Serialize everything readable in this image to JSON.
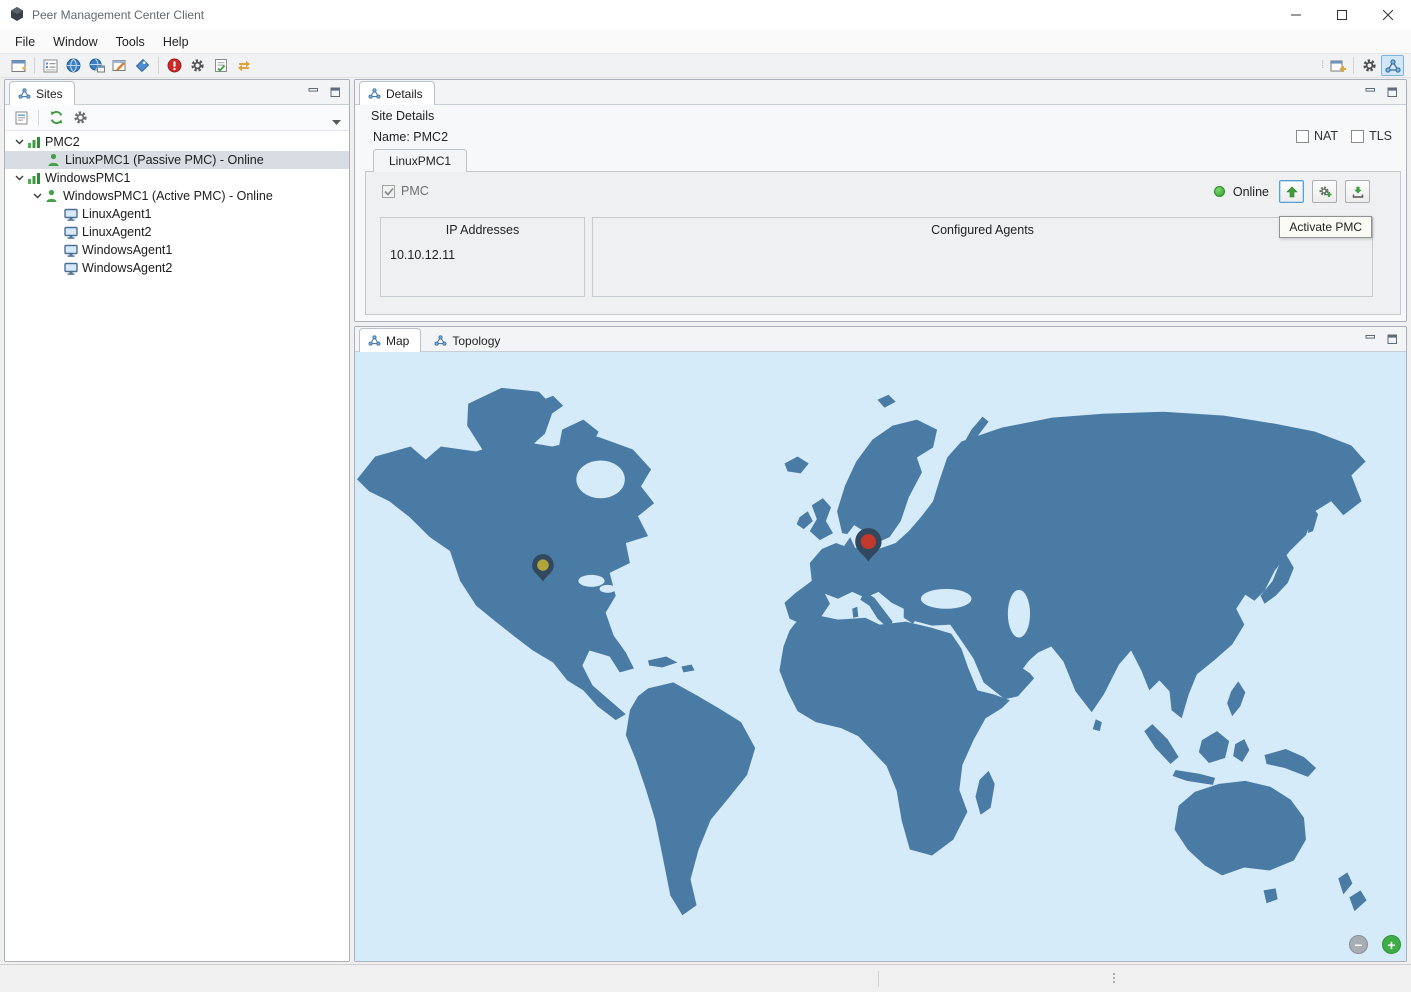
{
  "window": {
    "title": "Peer Management Center Client"
  },
  "menu": {
    "items": [
      "File",
      "Window",
      "Tools",
      "Help"
    ]
  },
  "toolbar": {
    "left_icons": [
      "new-window-icon",
      "form-list-icon",
      "globe-icon",
      "globe-sites-icon",
      "edit-window-icon",
      "tag-icon",
      "stop-icon",
      "gear-icon",
      "task-check-icon",
      "sync-arrows-icon"
    ],
    "right_icons": [
      "open-perspective-icon",
      "management-perspective-icon",
      "pmc-perspective-icon"
    ]
  },
  "sites": {
    "tab_label": "Sites",
    "toolbar_icons": [
      "report-icon",
      "refresh-icon",
      "gear-icon",
      "view-menu-icon"
    ],
    "tree": [
      {
        "label": "PMC2"
      },
      {
        "label": "LinuxPMC1 (Passive PMC) - Online"
      },
      {
        "label": "WindowsPMC1"
      },
      {
        "label": "WindowsPMC1 (Active PMC) - Online"
      },
      {
        "label": "LinuxAgent1"
      },
      {
        "label": "LinuxAgent2"
      },
      {
        "label": "WindowsAgent1"
      },
      {
        "label": "WindowsAgent2"
      }
    ]
  },
  "details": {
    "tab_label": "Details",
    "section_title": "Site Details",
    "name_label": "Name: PMC2",
    "nat_label": "NAT",
    "tls_label": "TLS",
    "pmc_tab_label": "LinuxPMC1",
    "pmc_checkbox_label": "PMC",
    "status_label": "Online",
    "tooltip": "Activate PMC",
    "ip_group": {
      "title": "IP Addresses",
      "value": "10.10.12.11"
    },
    "agents_group": {
      "title": "Configured Agents"
    }
  },
  "map": {
    "tab_map": "Map",
    "tab_topology": "Topology",
    "pins": [
      {
        "name": "us-pin",
        "center_color": "#b0a43b"
      },
      {
        "name": "europe-pin",
        "center_color": "#c2392b"
      }
    ],
    "zoom_out_label": "−",
    "zoom_in_label": "+"
  },
  "colors": {
    "ocean": "#d6ebf9",
    "land": "#4a7ba4",
    "selection": "#d7dde3",
    "pin_us": "#b0a43b",
    "pin_eu": "#c2392b",
    "pin_body": "#32485e",
    "accent_green": "#3fae49"
  }
}
